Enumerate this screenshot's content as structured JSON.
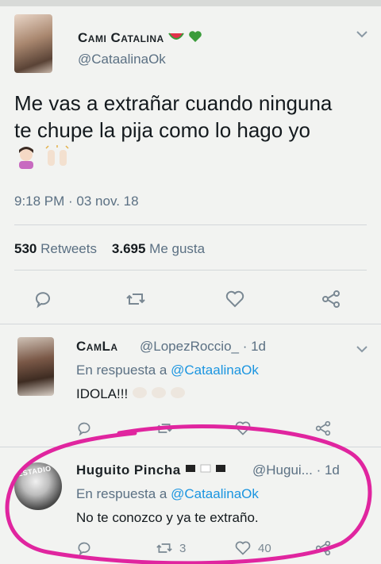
{
  "main_tweet": {
    "display_name": "Cami Catalina",
    "handle": "@CataalinaOk",
    "text_line1": "Me vas a extrañar cuando ninguna",
    "text_line2": "te chupe la pija como lo hago yo",
    "timestamp": "9:18 PM · 03 nov. 18",
    "retweets_count": "530",
    "retweets_label": "Retweets",
    "likes_count": "3.695",
    "likes_label": "Me gusta"
  },
  "replies": [
    {
      "display_name": "CamLa",
      "handle_time": "@LopezRoccio_ · 1d",
      "in_reply_prefix": "En respuesta a ",
      "in_reply_handle": "@CataalinaOk",
      "text": "IDOLA!!!"
    },
    {
      "display_name": "Huguito Pincha",
      "handle_time": "@Hugui... · 1d",
      "in_reply_prefix": "En respuesta a ",
      "in_reply_handle": "@CataalinaOk",
      "text": "No te conozco y ya te extraño.",
      "retweets_count": "3",
      "likes_count": "40",
      "avatar_text": "ESTADIO"
    }
  ],
  "colors": {
    "accent": "#1b95e0",
    "muted": "#5b7083",
    "highlight_circle": "#e0259f"
  }
}
